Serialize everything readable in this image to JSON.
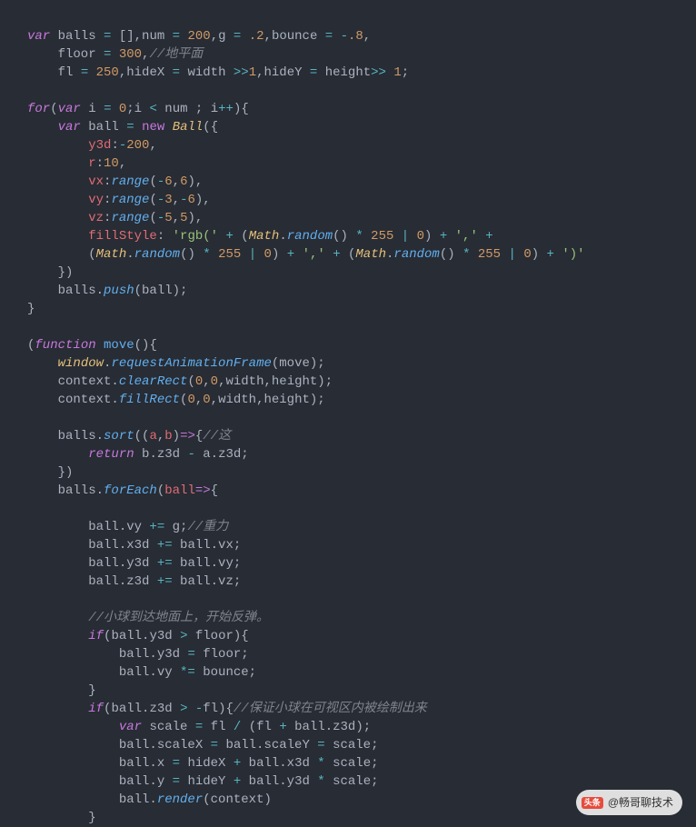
{
  "code": {
    "l1": [
      {
        "c": "kw",
        "t": "var"
      },
      {
        "c": "txt",
        "t": " balls "
      },
      {
        "c": "op",
        "t": "="
      },
      {
        "c": "txt",
        "t": " "
      },
      {
        "c": "bracket",
        "t": "[]"
      },
      {
        "c": "txt",
        "t": ",num "
      },
      {
        "c": "op",
        "t": "="
      },
      {
        "c": "txt",
        "t": " "
      },
      {
        "c": "num",
        "t": "200"
      },
      {
        "c": "txt",
        "t": ",g "
      },
      {
        "c": "op",
        "t": "="
      },
      {
        "c": "txt",
        "t": " "
      },
      {
        "c": "num",
        "t": ".2"
      },
      {
        "c": "txt",
        "t": ",bounce "
      },
      {
        "c": "op",
        "t": "="
      },
      {
        "c": "txt",
        "t": " "
      },
      {
        "c": "op",
        "t": "-"
      },
      {
        "c": "num",
        "t": ".8"
      },
      {
        "c": "txt",
        "t": ","
      }
    ],
    "l2": [
      {
        "c": "txt",
        "t": "    floor "
      },
      {
        "c": "op",
        "t": "="
      },
      {
        "c": "txt",
        "t": " "
      },
      {
        "c": "num",
        "t": "300"
      },
      {
        "c": "txt",
        "t": ","
      },
      {
        "c": "comment",
        "t": "//地平面"
      }
    ],
    "l3": [
      {
        "c": "txt",
        "t": "    fl "
      },
      {
        "c": "op",
        "t": "="
      },
      {
        "c": "txt",
        "t": " "
      },
      {
        "c": "num",
        "t": "250"
      },
      {
        "c": "txt",
        "t": ",hideX "
      },
      {
        "c": "op",
        "t": "="
      },
      {
        "c": "txt",
        "t": " width "
      },
      {
        "c": "op",
        "t": ">>"
      },
      {
        "c": "num",
        "t": "1"
      },
      {
        "c": "txt",
        "t": ",hideY "
      },
      {
        "c": "op",
        "t": "="
      },
      {
        "c": "txt",
        "t": " height"
      },
      {
        "c": "op",
        "t": ">>"
      },
      {
        "c": "txt",
        "t": " "
      },
      {
        "c": "num",
        "t": "1"
      },
      {
        "c": "txt",
        "t": ";"
      }
    ],
    "l4": [],
    "l5": [
      {
        "c": "kw",
        "t": "for"
      },
      {
        "c": "paren",
        "t": "("
      },
      {
        "c": "kw",
        "t": "var"
      },
      {
        "c": "txt",
        "t": " i "
      },
      {
        "c": "op",
        "t": "="
      },
      {
        "c": "txt",
        "t": " "
      },
      {
        "c": "num",
        "t": "0"
      },
      {
        "c": "txt",
        "t": ";i "
      },
      {
        "c": "op",
        "t": "<"
      },
      {
        "c": "txt",
        "t": " num ; i"
      },
      {
        "c": "op",
        "t": "++"
      },
      {
        "c": "paren",
        "t": ")"
      },
      {
        "c": "bracket",
        "t": "{"
      }
    ],
    "l6": [
      {
        "c": "txt",
        "t": "    "
      },
      {
        "c": "kw",
        "t": "var"
      },
      {
        "c": "txt",
        "t": " ball "
      },
      {
        "c": "op",
        "t": "="
      },
      {
        "c": "txt",
        "t": " "
      },
      {
        "c": "new-kw",
        "t": "new"
      },
      {
        "c": "txt",
        "t": " "
      },
      {
        "c": "class-name",
        "t": "Ball"
      },
      {
        "c": "paren",
        "t": "("
      },
      {
        "c": "bracket",
        "t": "{"
      }
    ],
    "l7": [
      {
        "c": "txt",
        "t": "        "
      },
      {
        "c": "prop",
        "t": "y3d"
      },
      {
        "c": "txt",
        "t": ":"
      },
      {
        "c": "op",
        "t": "-"
      },
      {
        "c": "num",
        "t": "200"
      },
      {
        "c": "txt",
        "t": ","
      }
    ],
    "l8": [
      {
        "c": "txt",
        "t": "        "
      },
      {
        "c": "prop",
        "t": "r"
      },
      {
        "c": "txt",
        "t": ":"
      },
      {
        "c": "num",
        "t": "10"
      },
      {
        "c": "txt",
        "t": ","
      }
    ],
    "l9": [
      {
        "c": "txt",
        "t": "        "
      },
      {
        "c": "prop",
        "t": "vx"
      },
      {
        "c": "txt",
        "t": ":"
      },
      {
        "c": "fn",
        "t": "range"
      },
      {
        "c": "paren",
        "t": "("
      },
      {
        "c": "op",
        "t": "-"
      },
      {
        "c": "num",
        "t": "6"
      },
      {
        "c": "txt",
        "t": ","
      },
      {
        "c": "num",
        "t": "6"
      },
      {
        "c": "paren",
        "t": ")"
      },
      {
        "c": "txt",
        "t": ","
      }
    ],
    "l10": [
      {
        "c": "txt",
        "t": "        "
      },
      {
        "c": "prop",
        "t": "vy"
      },
      {
        "c": "txt",
        "t": ":"
      },
      {
        "c": "fn",
        "t": "range"
      },
      {
        "c": "paren",
        "t": "("
      },
      {
        "c": "op",
        "t": "-"
      },
      {
        "c": "num",
        "t": "3"
      },
      {
        "c": "txt",
        "t": ","
      },
      {
        "c": "op",
        "t": "-"
      },
      {
        "c": "num",
        "t": "6"
      },
      {
        "c": "paren",
        "t": ")"
      },
      {
        "c": "txt",
        "t": ","
      }
    ],
    "l11": [
      {
        "c": "txt",
        "t": "        "
      },
      {
        "c": "prop",
        "t": "vz"
      },
      {
        "c": "txt",
        "t": ":"
      },
      {
        "c": "fn",
        "t": "range"
      },
      {
        "c": "paren",
        "t": "("
      },
      {
        "c": "op",
        "t": "-"
      },
      {
        "c": "num",
        "t": "5"
      },
      {
        "c": "txt",
        "t": ","
      },
      {
        "c": "num",
        "t": "5"
      },
      {
        "c": "paren",
        "t": ")"
      },
      {
        "c": "txt",
        "t": ","
      }
    ],
    "l12": [
      {
        "c": "txt",
        "t": "        "
      },
      {
        "c": "prop",
        "t": "fillStyle"
      },
      {
        "c": "txt",
        "t": ": "
      },
      {
        "c": "str",
        "t": "'rgb('"
      },
      {
        "c": "txt",
        "t": " "
      },
      {
        "c": "op",
        "t": "+"
      },
      {
        "c": "txt",
        "t": " "
      },
      {
        "c": "paren",
        "t": "("
      },
      {
        "c": "class-name",
        "t": "Math"
      },
      {
        "c": "txt",
        "t": "."
      },
      {
        "c": "fn",
        "t": "random"
      },
      {
        "c": "paren",
        "t": "()"
      },
      {
        "c": "txt",
        "t": " "
      },
      {
        "c": "op",
        "t": "*"
      },
      {
        "c": "txt",
        "t": " "
      },
      {
        "c": "num",
        "t": "255"
      },
      {
        "c": "txt",
        "t": " "
      },
      {
        "c": "op",
        "t": "|"
      },
      {
        "c": "txt",
        "t": " "
      },
      {
        "c": "num",
        "t": "0"
      },
      {
        "c": "paren",
        "t": ")"
      },
      {
        "c": "txt",
        "t": " "
      },
      {
        "c": "op",
        "t": "+"
      },
      {
        "c": "txt",
        "t": " "
      },
      {
        "c": "str",
        "t": "','"
      },
      {
        "c": "txt",
        "t": " "
      },
      {
        "c": "op",
        "t": "+"
      }
    ],
    "l13": [
      {
        "c": "txt",
        "t": "        "
      },
      {
        "c": "paren",
        "t": "("
      },
      {
        "c": "class-name",
        "t": "Math"
      },
      {
        "c": "txt",
        "t": "."
      },
      {
        "c": "fn",
        "t": "random"
      },
      {
        "c": "paren",
        "t": "()"
      },
      {
        "c": "txt",
        "t": " "
      },
      {
        "c": "op",
        "t": "*"
      },
      {
        "c": "txt",
        "t": " "
      },
      {
        "c": "num",
        "t": "255"
      },
      {
        "c": "txt",
        "t": " "
      },
      {
        "c": "op",
        "t": "|"
      },
      {
        "c": "txt",
        "t": " "
      },
      {
        "c": "num",
        "t": "0"
      },
      {
        "c": "paren",
        "t": ")"
      },
      {
        "c": "txt",
        "t": " "
      },
      {
        "c": "op",
        "t": "+"
      },
      {
        "c": "txt",
        "t": " "
      },
      {
        "c": "str",
        "t": "','"
      },
      {
        "c": "txt",
        "t": " "
      },
      {
        "c": "op",
        "t": "+"
      },
      {
        "c": "txt",
        "t": " "
      },
      {
        "c": "paren",
        "t": "("
      },
      {
        "c": "class-name",
        "t": "Math"
      },
      {
        "c": "txt",
        "t": "."
      },
      {
        "c": "fn",
        "t": "random"
      },
      {
        "c": "paren",
        "t": "()"
      },
      {
        "c": "txt",
        "t": " "
      },
      {
        "c": "op",
        "t": "*"
      },
      {
        "c": "txt",
        "t": " "
      },
      {
        "c": "num",
        "t": "255"
      },
      {
        "c": "txt",
        "t": " "
      },
      {
        "c": "op",
        "t": "|"
      },
      {
        "c": "txt",
        "t": " "
      },
      {
        "c": "num",
        "t": "0"
      },
      {
        "c": "paren",
        "t": ")"
      },
      {
        "c": "txt",
        "t": " "
      },
      {
        "c": "op",
        "t": "+"
      },
      {
        "c": "txt",
        "t": " "
      },
      {
        "c": "str",
        "t": "')'"
      }
    ],
    "l14": [
      {
        "c": "txt",
        "t": "    "
      },
      {
        "c": "bracket",
        "t": "}"
      },
      {
        "c": "paren",
        "t": ")"
      }
    ],
    "l15": [
      {
        "c": "txt",
        "t": "    balls."
      },
      {
        "c": "fn",
        "t": "push"
      },
      {
        "c": "paren",
        "t": "("
      },
      {
        "c": "txt",
        "t": "ball"
      },
      {
        "c": "paren",
        "t": ")"
      },
      {
        "c": "txt",
        "t": ";"
      }
    ],
    "l16": [
      {
        "c": "bracket",
        "t": "}"
      }
    ],
    "l17": [],
    "l18": [
      {
        "c": "paren",
        "t": "("
      },
      {
        "c": "fn-decl",
        "t": "function"
      },
      {
        "c": "txt",
        "t": " "
      },
      {
        "c": "fn-name",
        "t": "move"
      },
      {
        "c": "paren",
        "t": "()"
      },
      {
        "c": "bracket",
        "t": "{"
      }
    ],
    "l19": [
      {
        "c": "txt",
        "t": "    "
      },
      {
        "c": "class-name",
        "t": "window"
      },
      {
        "c": "txt",
        "t": "."
      },
      {
        "c": "fn",
        "t": "requestAnimationFrame"
      },
      {
        "c": "paren",
        "t": "("
      },
      {
        "c": "txt",
        "t": "move"
      },
      {
        "c": "paren",
        "t": ")"
      },
      {
        "c": "txt",
        "t": ";"
      }
    ],
    "l20": [
      {
        "c": "txt",
        "t": "    context."
      },
      {
        "c": "fn",
        "t": "clearRect"
      },
      {
        "c": "paren",
        "t": "("
      },
      {
        "c": "num",
        "t": "0"
      },
      {
        "c": "txt",
        "t": ","
      },
      {
        "c": "num",
        "t": "0"
      },
      {
        "c": "txt",
        "t": ",width,height"
      },
      {
        "c": "paren",
        "t": ")"
      },
      {
        "c": "txt",
        "t": ";"
      }
    ],
    "l21": [
      {
        "c": "txt",
        "t": "    context."
      },
      {
        "c": "fn",
        "t": "fillRect"
      },
      {
        "c": "paren",
        "t": "("
      },
      {
        "c": "num",
        "t": "0"
      },
      {
        "c": "txt",
        "t": ","
      },
      {
        "c": "num",
        "t": "0"
      },
      {
        "c": "txt",
        "t": ",width,height"
      },
      {
        "c": "paren",
        "t": ")"
      },
      {
        "c": "txt",
        "t": ";"
      }
    ],
    "l22": [],
    "l23": [
      {
        "c": "txt",
        "t": "    balls."
      },
      {
        "c": "fn",
        "t": "sort"
      },
      {
        "c": "paren",
        "t": "(("
      },
      {
        "c": "var-name",
        "t": "a"
      },
      {
        "c": "txt",
        "t": ","
      },
      {
        "c": "var-name",
        "t": "b"
      },
      {
        "c": "paren",
        "t": ")"
      },
      {
        "c": "arrow",
        "t": "=>"
      },
      {
        "c": "bracket",
        "t": "{"
      },
      {
        "c": "comment",
        "t": "//这"
      }
    ],
    "l24": [
      {
        "c": "txt",
        "t": "        "
      },
      {
        "c": "kw",
        "t": "return"
      },
      {
        "c": "txt",
        "t": " b.z3d "
      },
      {
        "c": "op",
        "t": "-"
      },
      {
        "c": "txt",
        "t": " a.z3d;"
      }
    ],
    "l25": [
      {
        "c": "txt",
        "t": "    "
      },
      {
        "c": "bracket",
        "t": "}"
      },
      {
        "c": "paren",
        "t": ")"
      }
    ],
    "l26": [
      {
        "c": "txt",
        "t": "    balls."
      },
      {
        "c": "fn",
        "t": "forEach"
      },
      {
        "c": "paren",
        "t": "("
      },
      {
        "c": "var-name",
        "t": "ball"
      },
      {
        "c": "arrow",
        "t": "=>"
      },
      {
        "c": "bracket",
        "t": "{"
      }
    ],
    "l27": [],
    "l28": [
      {
        "c": "txt",
        "t": "        ball.vy "
      },
      {
        "c": "op",
        "t": "+="
      },
      {
        "c": "txt",
        "t": " g;"
      },
      {
        "c": "comment",
        "t": "//重力"
      }
    ],
    "l29": [
      {
        "c": "txt",
        "t": "        ball.x3d "
      },
      {
        "c": "op",
        "t": "+="
      },
      {
        "c": "txt",
        "t": " ball.vx;"
      }
    ],
    "l30": [
      {
        "c": "txt",
        "t": "        ball.y3d "
      },
      {
        "c": "op",
        "t": "+="
      },
      {
        "c": "txt",
        "t": " ball.vy;"
      }
    ],
    "l31": [
      {
        "c": "txt",
        "t": "        ball.z3d "
      },
      {
        "c": "op",
        "t": "+="
      },
      {
        "c": "txt",
        "t": " ball.vz;"
      }
    ],
    "l32": [],
    "l33": [
      {
        "c": "txt",
        "t": "        "
      },
      {
        "c": "comment",
        "t": "//小球到达地面上，开始反弹。"
      }
    ],
    "l34": [
      {
        "c": "txt",
        "t": "        "
      },
      {
        "c": "kw",
        "t": "if"
      },
      {
        "c": "paren",
        "t": "("
      },
      {
        "c": "txt",
        "t": "ball.y3d "
      },
      {
        "c": "op",
        "t": ">"
      },
      {
        "c": "txt",
        "t": " floor"
      },
      {
        "c": "paren",
        "t": ")"
      },
      {
        "c": "bracket",
        "t": "{"
      }
    ],
    "l35": [
      {
        "c": "txt",
        "t": "            ball.y3d "
      },
      {
        "c": "op",
        "t": "="
      },
      {
        "c": "txt",
        "t": " floor;"
      }
    ],
    "l36": [
      {
        "c": "txt",
        "t": "            ball.vy "
      },
      {
        "c": "op",
        "t": "*="
      },
      {
        "c": "txt",
        "t": " bounce;"
      }
    ],
    "l37": [
      {
        "c": "txt",
        "t": "        "
      },
      {
        "c": "bracket",
        "t": "}"
      }
    ],
    "l38": [
      {
        "c": "txt",
        "t": "        "
      },
      {
        "c": "kw",
        "t": "if"
      },
      {
        "c": "paren",
        "t": "("
      },
      {
        "c": "txt",
        "t": "ball.z3d "
      },
      {
        "c": "op",
        "t": ">"
      },
      {
        "c": "txt",
        "t": " "
      },
      {
        "c": "op",
        "t": "-"
      },
      {
        "c": "txt",
        "t": "fl"
      },
      {
        "c": "paren",
        "t": ")"
      },
      {
        "c": "bracket",
        "t": "{"
      },
      {
        "c": "comment",
        "t": "//保证小球在可视区内被绘制出来"
      }
    ],
    "l39": [
      {
        "c": "txt",
        "t": "            "
      },
      {
        "c": "kw",
        "t": "var"
      },
      {
        "c": "txt",
        "t": " scale "
      },
      {
        "c": "op",
        "t": "="
      },
      {
        "c": "txt",
        "t": " fl "
      },
      {
        "c": "op",
        "t": "/"
      },
      {
        "c": "txt",
        "t": " "
      },
      {
        "c": "paren",
        "t": "("
      },
      {
        "c": "txt",
        "t": "fl "
      },
      {
        "c": "op",
        "t": "+"
      },
      {
        "c": "txt",
        "t": " ball.z3d"
      },
      {
        "c": "paren",
        "t": ")"
      },
      {
        "c": "txt",
        "t": ";"
      }
    ],
    "l40": [
      {
        "c": "txt",
        "t": "            ball.scaleX "
      },
      {
        "c": "op",
        "t": "="
      },
      {
        "c": "txt",
        "t": " ball.scaleY "
      },
      {
        "c": "op",
        "t": "="
      },
      {
        "c": "txt",
        "t": " scale;"
      }
    ],
    "l41": [
      {
        "c": "txt",
        "t": "            ball.x "
      },
      {
        "c": "op",
        "t": "="
      },
      {
        "c": "txt",
        "t": " hideX "
      },
      {
        "c": "op",
        "t": "+"
      },
      {
        "c": "txt",
        "t": " ball.x3d "
      },
      {
        "c": "op",
        "t": "*"
      },
      {
        "c": "txt",
        "t": " scale;"
      }
    ],
    "l42": [
      {
        "c": "txt",
        "t": "            ball.y "
      },
      {
        "c": "op",
        "t": "="
      },
      {
        "c": "txt",
        "t": " hideY "
      },
      {
        "c": "op",
        "t": "+"
      },
      {
        "c": "txt",
        "t": " ball.y3d "
      },
      {
        "c": "op",
        "t": "*"
      },
      {
        "c": "txt",
        "t": " scale;"
      }
    ],
    "l43": [
      {
        "c": "txt",
        "t": "            ball."
      },
      {
        "c": "fn",
        "t": "render"
      },
      {
        "c": "paren",
        "t": "("
      },
      {
        "c": "txt",
        "t": "context"
      },
      {
        "c": "paren",
        "t": ")"
      }
    ],
    "l44": [
      {
        "c": "txt",
        "t": "        "
      },
      {
        "c": "bracket",
        "t": "}"
      }
    ]
  },
  "watermark": {
    "logo": "头条",
    "text": "@畅哥聊技术"
  }
}
